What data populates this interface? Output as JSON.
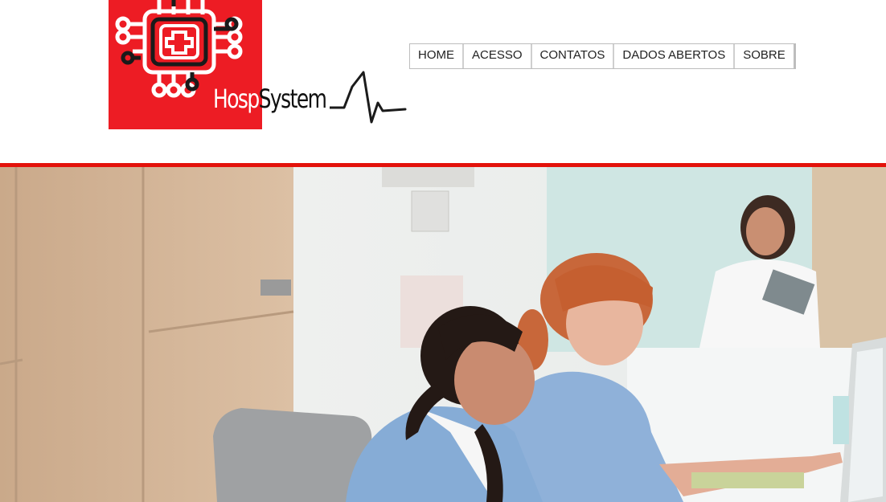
{
  "brand": {
    "name_part1": "Hosp",
    "name_part2": "System",
    "colors": {
      "red": "#ed1c24",
      "dark": "#111111",
      "rule": "#e3120b"
    }
  },
  "nav": {
    "items": [
      {
        "label": "HOME"
      },
      {
        "label": "ACESSO"
      },
      {
        "label": "CONTATOS"
      },
      {
        "label": "DADOS ABERTOS"
      },
      {
        "label": "SOBRE"
      }
    ]
  },
  "hero": {
    "icon": "hero-photo-nurses-at-reception"
  }
}
